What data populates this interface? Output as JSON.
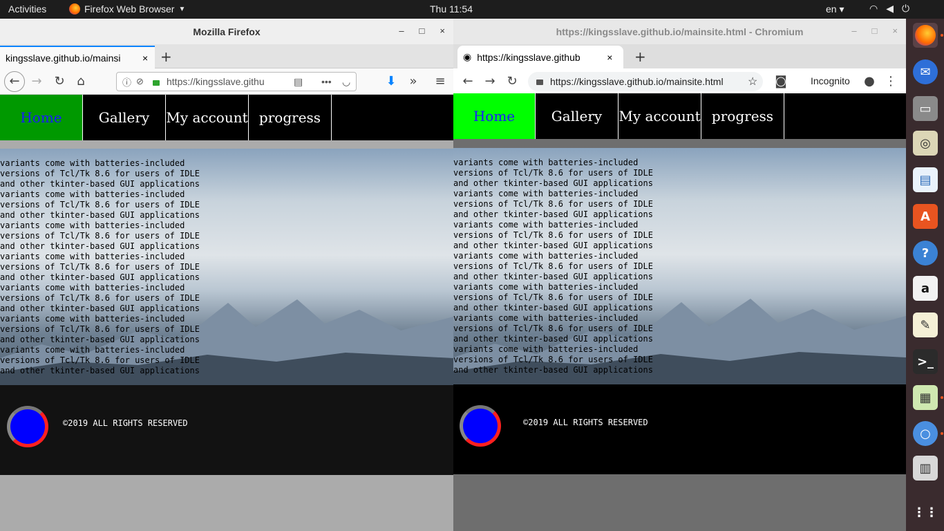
{
  "topbar": {
    "activities": "Activities",
    "app_name": "Firefox Web Browser",
    "clock": "Thu 11:54",
    "lang": "en"
  },
  "firefox": {
    "window_title": "Mozilla Firefox",
    "tab_title": "kingsslave.github.io/mainsi",
    "url": "https://kingsslave.githu"
  },
  "chromium": {
    "window_title": "https://kingsslave.github.io/mainsite.html - Chromium",
    "tab_title": "https://kingsslave.github",
    "url": "https://kingsslave.github.io/mainsite.html",
    "incognito": "Incognito"
  },
  "site": {
    "nav": [
      "Home",
      "Gallery",
      "My account",
      "progress"
    ],
    "body_lines": [
      "variants come with batteries-included",
      "versions of Tcl/Tk 8.6 for users of IDLE",
      "and other tkinter-based GUI applications",
      "variants come with batteries-included",
      "versions of Tcl/Tk 8.6 for users of IDLE",
      "and other tkinter-based GUI applications",
      "variants come with batteries-included",
      "versions of Tcl/Tk 8.6 for users of IDLE",
      "and other tkinter-based GUI applications",
      "variants come with batteries-included",
      "versions of Tcl/Tk 8.6 for users of IDLE",
      "and other tkinter-based GUI applications",
      "variants come with batteries-included",
      "versions of Tcl/Tk 8.6 for users of IDLE",
      "and other tkinter-based GUI applications",
      "variants come with batteries-included",
      "versions of Tcl/Tk 8.6 for users of IDLE",
      "and other tkinter-based GUI applications",
      "variants come with batteries-included",
      "versions of Tcl/Tk 8.6 for users of IDLE",
      "and other tkinter-based GUI applications"
    ],
    "copyright": "©2019 ALL RIGHTS RESERVED"
  },
  "colors": {
    "ff_home_bg": "#009900",
    "ff_home_text": "#1a1aff",
    "cr_home_bg": "#00ff00",
    "cr_home_text": "#1a1aff",
    "logo_blue": "#0000ff",
    "logo_ring": "#ff2020"
  }
}
